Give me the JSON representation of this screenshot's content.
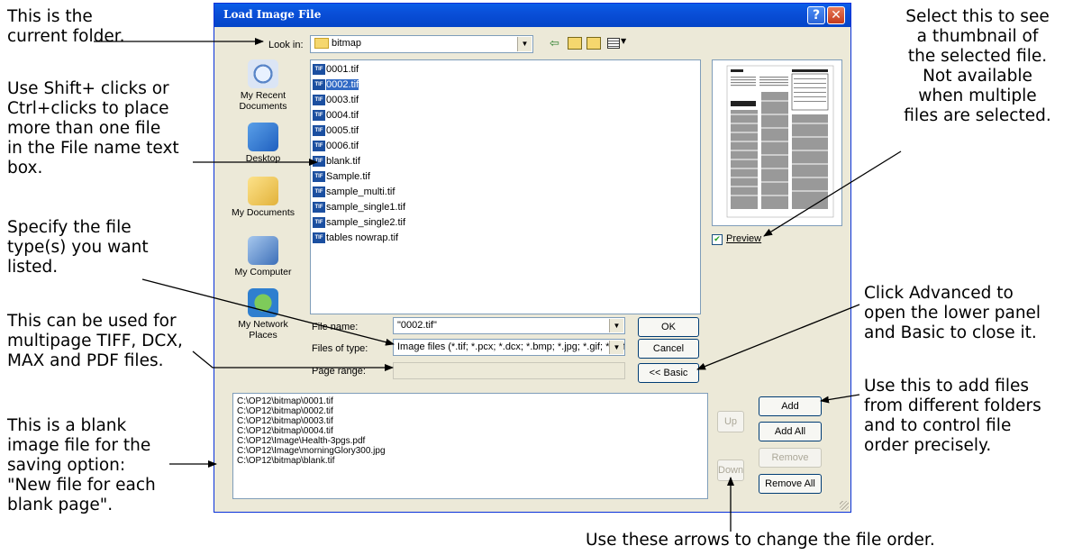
{
  "annotations": {
    "current_folder": "This is the\ncurrent folder.",
    "shift_clicks": "Use Shift+ clicks or\nCtrl+clicks to place\nmore than one file\nin the File name text\nbox.",
    "file_types": "Specify the file\ntype(s) you want\nlisted.",
    "multipage": "This can be used for\nmultipage TIFF, DCX,\nMAX and PDF files.",
    "blank_image": "This is a blank\nimage file for the\nsaving option:\n\"New file for each\nblank page\".",
    "thumbnail": "Select this to see\na thumbnail of\nthe selected file.\nNot available\nwhen multiple\nfiles are selected.",
    "advanced": "Click Advanced to\nopen the lower panel\nand Basic to close it.",
    "add_files": "Use this to add files\nfrom different folders\nand to control file\norder precisely.",
    "arrows": "Use these arrows to change the file order."
  },
  "dialog": {
    "title": "Load Image File",
    "help_label": "?",
    "close_label": "✕",
    "look_in_label": "Look in:",
    "look_in_value": "bitmap",
    "places": [
      "My Recent\nDocuments",
      "Desktop",
      "My Documents",
      "My Computer",
      "My Network\nPlaces"
    ],
    "files": [
      "0001.tif",
      "0002.tif",
      "0003.tif",
      "0004.tif",
      "0005.tif",
      "0006.tif",
      "blank.tif",
      "Sample.tif",
      "sample_multi.tif",
      "sample_single1.tif",
      "sample_single2.tif",
      "tables nowrap.tif"
    ],
    "file_icon_text": "TIF",
    "selected_file_index": 1,
    "preview_label": "Preview",
    "preview_checked": true,
    "file_name_label": "File name:",
    "file_name_value": "\"0002.tif\"",
    "files_of_type_label": "Files of type:",
    "files_of_type_value": "Image files (*.tif; *.pcx; *.dcx; *.bmp; *.jpg; *.gif; *.pdf",
    "page_range_label": "Page range:",
    "ok_label": "OK",
    "cancel_label": "Cancel",
    "basic_label": "<< Basic",
    "add_list": [
      "C:\\OP12\\bitmap\\0001.tif",
      "C:\\OP12\\bitmap\\0002.tif",
      "C:\\OP12\\bitmap\\0003.tif",
      "C:\\OP12\\bitmap\\0004.tif",
      "C:\\OP12\\Image\\Health-3pgs.pdf",
      "C:\\OP12\\Image\\morningGlory300.jpg",
      "C:\\OP12\\bitmap\\blank.tif"
    ],
    "up_label": "Up",
    "down_label": "Down",
    "add_label": "Add",
    "add_all_label": "Add All",
    "remove_label": "Remove",
    "remove_all_label": "Remove All"
  },
  "colors": {
    "title_bar": "#0a4fd8",
    "selection": "#316ac5",
    "dialog_bg": "#ece9d8"
  }
}
